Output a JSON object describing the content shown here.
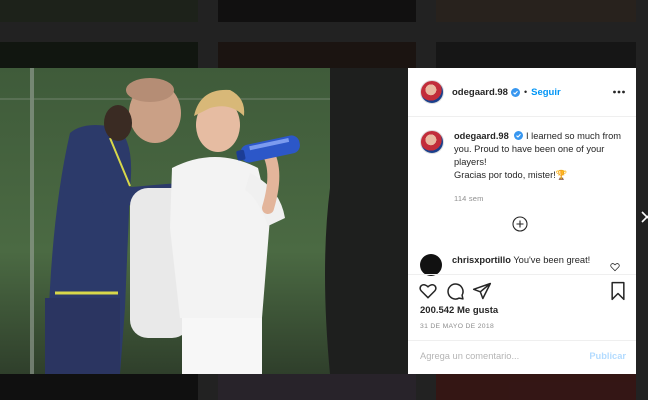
{
  "post": {
    "username": "odegaard.98",
    "separator": "•",
    "follow_label": "Seguir",
    "caption_lines": [
      "I learned so much from you. Proud to have been one of your players!",
      "Gracias por todo, mister!🏆"
    ],
    "caption_time": "114 sem",
    "comment": {
      "username": "chrisxportillo",
      "text": "You've been great!"
    },
    "likes_label": "200.542 Me gusta",
    "date_label": "31 DE MAYO DE 2018",
    "add_comment_placeholder": "Agrega un comentario...",
    "publish_label": "Publicar"
  },
  "colors": {
    "accent": "#0095f6",
    "text": "#262626",
    "muted": "#8e8e8e"
  },
  "icons": [
    "more-options-icon",
    "verified-icon",
    "add-comment-icon",
    "heart-icon",
    "comment-icon",
    "share-icon",
    "bookmark-icon",
    "comment-like-icon",
    "close-icon"
  ]
}
